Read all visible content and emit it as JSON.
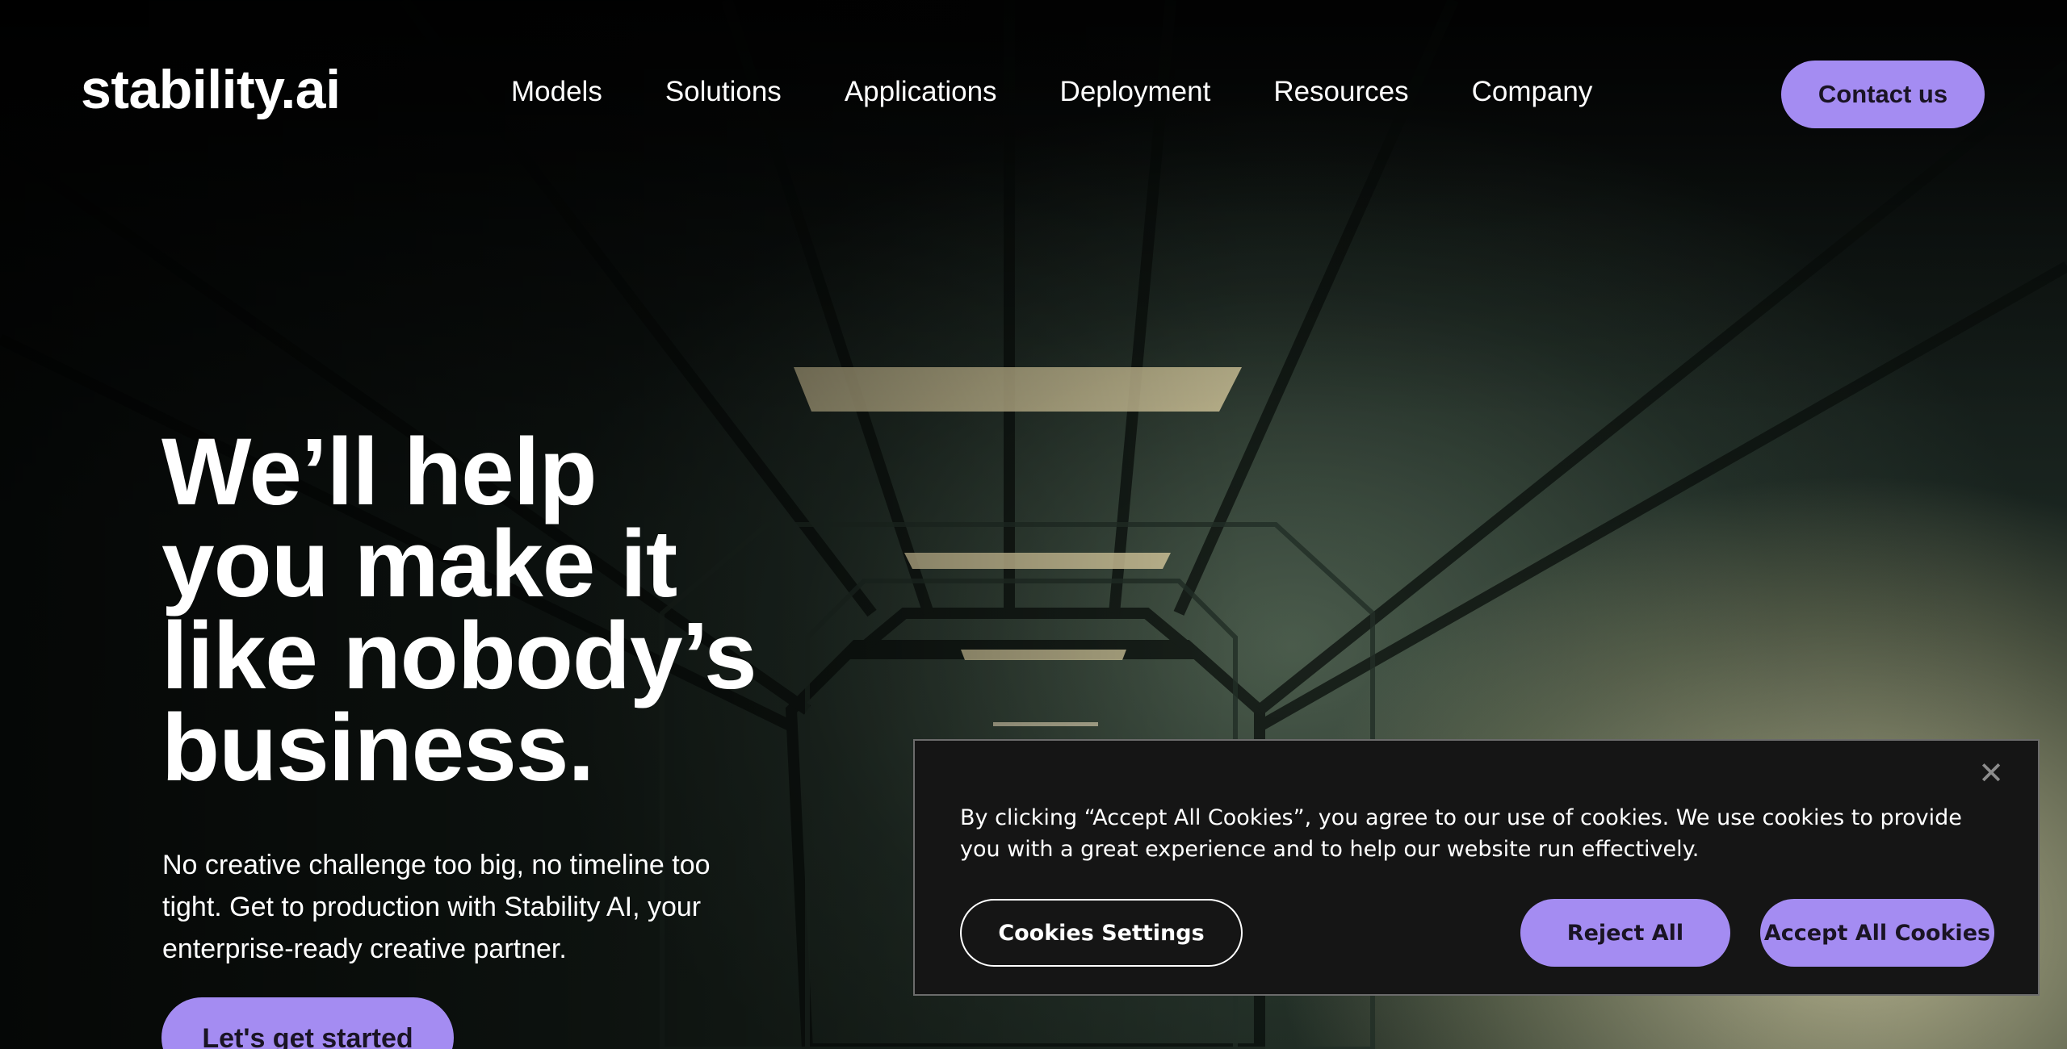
{
  "header": {
    "logo": "stability.ai",
    "nav": [
      {
        "label": "Models"
      },
      {
        "label": "Solutions"
      },
      {
        "label": "Applications"
      },
      {
        "label": "Deployment"
      },
      {
        "label": "Resources"
      },
      {
        "label": "Company"
      }
    ],
    "contact_label": "Contact us"
  },
  "hero": {
    "title_lines": [
      "We’ll help",
      "you make it",
      "like nobody’s",
      "business."
    ],
    "subtitle": "No creative challenge too big, no timeline too tight. Get to production with Stability AI, your enterprise-ready creative partner.",
    "cta_label": "Let's get started"
  },
  "cookie_banner": {
    "close_icon": "close-icon",
    "text": "By clicking “Accept All Cookies”, you agree to our use of cookies. We use cookies to provide you with a great experience and to help our website run effectively.",
    "settings_label": "Cookies Settings",
    "reject_label": "Reject All",
    "accept_label": "Accept All Cookies"
  },
  "colors": {
    "accent": "#a48cf2",
    "banner_bg": "#151515",
    "text": "#ffffff"
  }
}
